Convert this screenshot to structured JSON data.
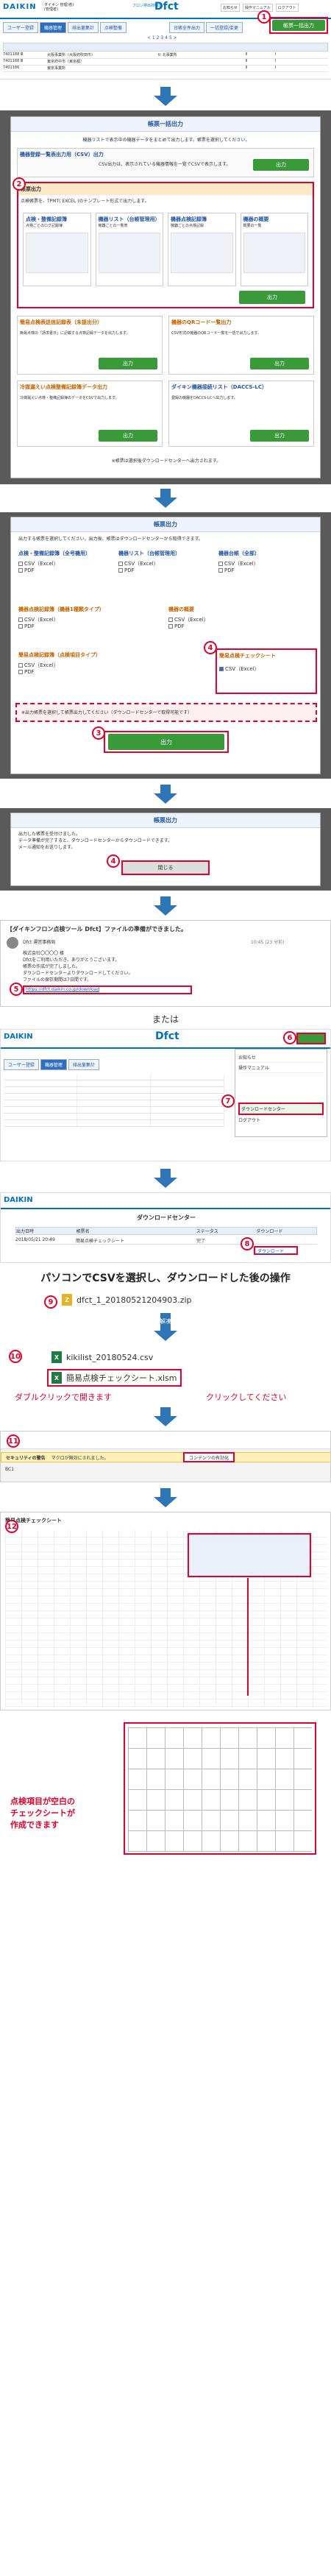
{
  "app": {
    "brand": "DAIKIN",
    "product": "Dfct",
    "product_prefix": "フロン排出抑制法",
    "user_lines": [
      "ダイキン 管理(者)",
      "(管理者)"
    ],
    "header_links": [
      "お知らせ",
      "操作マニュアル",
      "ログアウト"
    ],
    "tabs": [
      "ユーザー登録",
      "機器管理",
      "排出量集計",
      "点検整備",
      "機器管理者",
      "フロン報告書"
    ],
    "toolbar_buttons": [
      "台帳全件出力",
      "一括登録/変更",
      "帳票一括出力"
    ],
    "pagination": "< 1 2 3 4 5 >",
    "table_rows": [
      [
        "7401188 Ⅲ",
        "大阪事業所（大阪府吹田市）",
        "セ 北事業所",
        "Ⅱ",
        "Ⅰ"
      ],
      [
        "7401188 Ⅲ",
        "東京府中市（東京都）",
        "",
        "Ⅱ",
        "Ⅰ"
      ],
      [
        "7401186",
        "東京事業所",
        "",
        "Ⅱ",
        "Ⅰ"
      ]
    ]
  },
  "dialog1": {
    "title": "帳票一括出力",
    "intro": "機器リストで表示中の機器データをまとめて出力します。帳票を選択してください。",
    "csv_header": "機器登録一覧表出力用（CSV）出力",
    "csv_desc": "CSV出力は、表示されている機器情報を一覧でCSVで表示します。",
    "section_a": "帳票出力",
    "section_a_desc": "点検帳票を、TPMT( EXCEL )のテンプレート形式で出力します。",
    "cards": [
      {
        "title": "点検・整備記録簿",
        "desc": "点検ごとのログ記録簿"
      },
      {
        "title": "機器リスト（台帳管理用）",
        "desc": "機器ごとの一覧表"
      },
      {
        "title": "機器点検記録簿",
        "desc": "機器ごとの点検記録"
      },
      {
        "title": "機器の概要",
        "desc": "概要の一覧"
      }
    ],
    "section_b": "簡易点検表送信記録表（未提出分）",
    "section_b_desc": "簡易点検の「請求書日」に記載する点検記録データを出力します。",
    "section_c": "機器のQRコード一覧出力",
    "section_c_desc": "CSV形式の機器のQRコード一覧を一括で出力します。",
    "section_d": "冷媒漏えい点検整備記録簿データ出力",
    "section_d_desc": "冷媒漏えい点検・整備記録簿のデータをCSVで出力します。",
    "section_e": "ダイキン機器接続リスト（DACCS-LC）",
    "section_e_desc": "登録の機器をDACCS-LCへ出力します。",
    "output_button": "出力",
    "footer_note": "※帳票は選択後ダウンロードセンターへ出力されます。"
  },
  "dialog2": {
    "title": "帳票出力",
    "intro": "出力する帳票を選択してください。出力後、帳票はダウンロードセンターから取得できます。",
    "col1_header": "点検・整備記録簿（全号機用）",
    "col2_header": "機器リスト（台帳管理用）",
    "col3_header": "機器台帳（全部）",
    "col4_header": "機器点検記録簿（機器1種類タイプ）",
    "col5_header": "機器の概要",
    "col6_header": "簡易点検記録簿（点検項目タイプ）",
    "col7_header": "簡易点検チェックシート",
    "formats": [
      "CSV（Excel）",
      "PDF"
    ],
    "note": "※出力帳票を選択して帳票出力してください（ダウンロードセンターで取得可能です）",
    "output_button": "出力"
  },
  "dialog3": {
    "title": "帳票出力",
    "lines": [
      "出力した帳票を受付けました。",
      "データ準備が完了すると、ダウンロードセンターからダウンロードできます。",
      "メール通知をお送りします。"
    ],
    "close_button": "閉じる"
  },
  "mail": {
    "subject": "【ダイキンフロン点検ツール Dfct】ファイルの準備ができました。",
    "from": "Dfct 運営事務局",
    "time": "10:45 (23 分前)",
    "body": [
      "株式会社〇〇〇〇 様",
      "Dfctをご利用いただき、ありがとうございます。",
      "帳票の作成が完了しました。",
      "ダウンロードセンターよりダウンロードしてください。",
      "ファイルの保存期間は7日間です。"
    ],
    "link": "https://dfct.daikin.co.jp/download"
  },
  "or_text": "または",
  "dlcenter": {
    "title": "ダウンロードセンター",
    "header_cols": [
      "出力日時",
      "帳票名",
      "ステータス",
      "ダウンロード"
    ],
    "row": [
      "2018/05/21 20:49",
      "簡易点検チェックシート",
      "完了",
      "ダウンロード"
    ],
    "download_link": "ダウンロード"
  },
  "caption_pc": "パソコンでCSVを選択し、ダウンロードした後の操作",
  "zip_name": "dfct_1_20180521204903.zip",
  "unzip_label": "解凍",
  "file1": "kikilist_20180524.csv",
  "file2": "簡易点検チェックシート.xlsm",
  "dblclick_note": "ダブルクリックで開きます",
  "click_note": "クリックしてください",
  "excel": {
    "warning": "セキュリティの警告",
    "warning_msg": "マクロが無効にされました。",
    "enable_btn": "コンテンツの有効化",
    "cellref": "BC1"
  },
  "sheet_title": "簡易点検チェックシート",
  "final_note": "点検項目が空白の\nチェックシートが\n作成できます",
  "badges": [
    "1",
    "2",
    "3",
    "4",
    "5",
    "6",
    "7",
    "8",
    "9",
    "10",
    "11",
    "12"
  ],
  "colors": {
    "accent": "#e4002b",
    "arrow": "#2e75b6",
    "brand": "#0071bc",
    "green": "#3a9a3a"
  }
}
